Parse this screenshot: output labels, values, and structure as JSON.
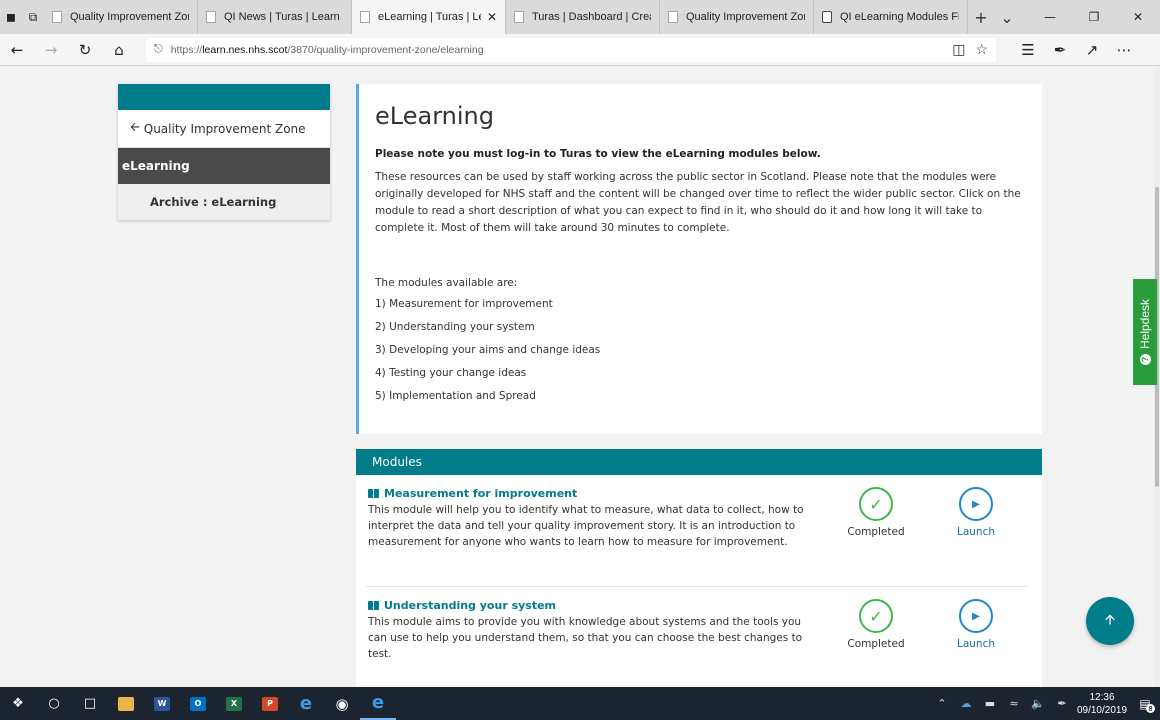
{
  "browser": {
    "tabs": [
      {
        "title": "Quality Improvement Zor",
        "active": false,
        "closable": false
      },
      {
        "title": "QI News | Turas | Learn",
        "active": false,
        "closable": false
      },
      {
        "title": "eLearning | Turas | Le",
        "active": true,
        "closable": true
      },
      {
        "title": "Turas | Dashboard | Creat",
        "active": false,
        "closable": false
      },
      {
        "title": "Quality Improvement Zor",
        "active": false,
        "closable": false
      },
      {
        "title": "QI eLearning Modules Fir",
        "active": false,
        "closable": false
      }
    ],
    "close_glyph": "✕",
    "url_prefix": "https://",
    "url_host": "learn.nes.nhs.scot",
    "url_path": "/3870/quality-improvement-zone/elearning",
    "icons": [
      "back-icon",
      "forward-icon",
      "refresh-icon",
      "home-icon",
      "lock-icon",
      "reading-view-icon",
      "favorite-star-icon",
      "favorites-hub-icon",
      "pen-icon",
      "share-icon",
      "more-icon"
    ]
  },
  "sidebar": {
    "back_label": "Quality Improvement Zone",
    "active_label": "eLearning",
    "sub_label": "Archive : eLearning"
  },
  "content": {
    "title": "eLearning",
    "note": "Please note you must log-in to Turas to view the eLearning modules below.",
    "paragraph": "These resources can be used by staff working across the public sector in Scotland. Please note that the modules were originally developed for NHS staff and the content will be changed over time to reflect the wider public sector. Click on the module to read a short description of what you can expect to find in it, who should do it and how long it will take to complete it. Most of them will take around 30 minutes to complete.",
    "modules_intro": "The modules available are:",
    "module_list": [
      "1) Measurement for improvement",
      "2) Understanding your system",
      "3) Developing your aims and change ideas",
      "4) Testing your change ideas",
      "5) Implementation and Spread"
    ]
  },
  "modules": {
    "header": "Modules",
    "items": [
      {
        "title": "Measurement for improvement",
        "description": "This module will help you to identify what to measure, what data to collect, how to interpret the data and tell your quality improvement story. It is an introduction to measurement for anyone who wants to learn how to measure for improvement.",
        "status_label": "Completed",
        "launch_label": "Launch"
      },
      {
        "title": "Understanding your system",
        "description": "This module aims to provide you with knowledge about systems and the tools you can use to help you understand them, so that you can choose the best changes to test.",
        "status_label": "Completed",
        "launch_label": "Launch"
      }
    ]
  },
  "helpdesk": {
    "label": "Helpdesk"
  },
  "taskbar": {
    "time": "12:36",
    "date": "09/10/2019",
    "notification_count": "8",
    "word_label": "W",
    "outlook_label": "O",
    "excel_label": "X",
    "powerpoint_label": "P"
  },
  "colors": {
    "brand_teal": "#007c8a",
    "accent_blue": "#5fa8dc",
    "completed_green": "#3fb84b",
    "launch_blue": "#1a88c9",
    "helpdesk_green": "#2a9d3b",
    "sidebar_active": "#4a4a4a"
  }
}
